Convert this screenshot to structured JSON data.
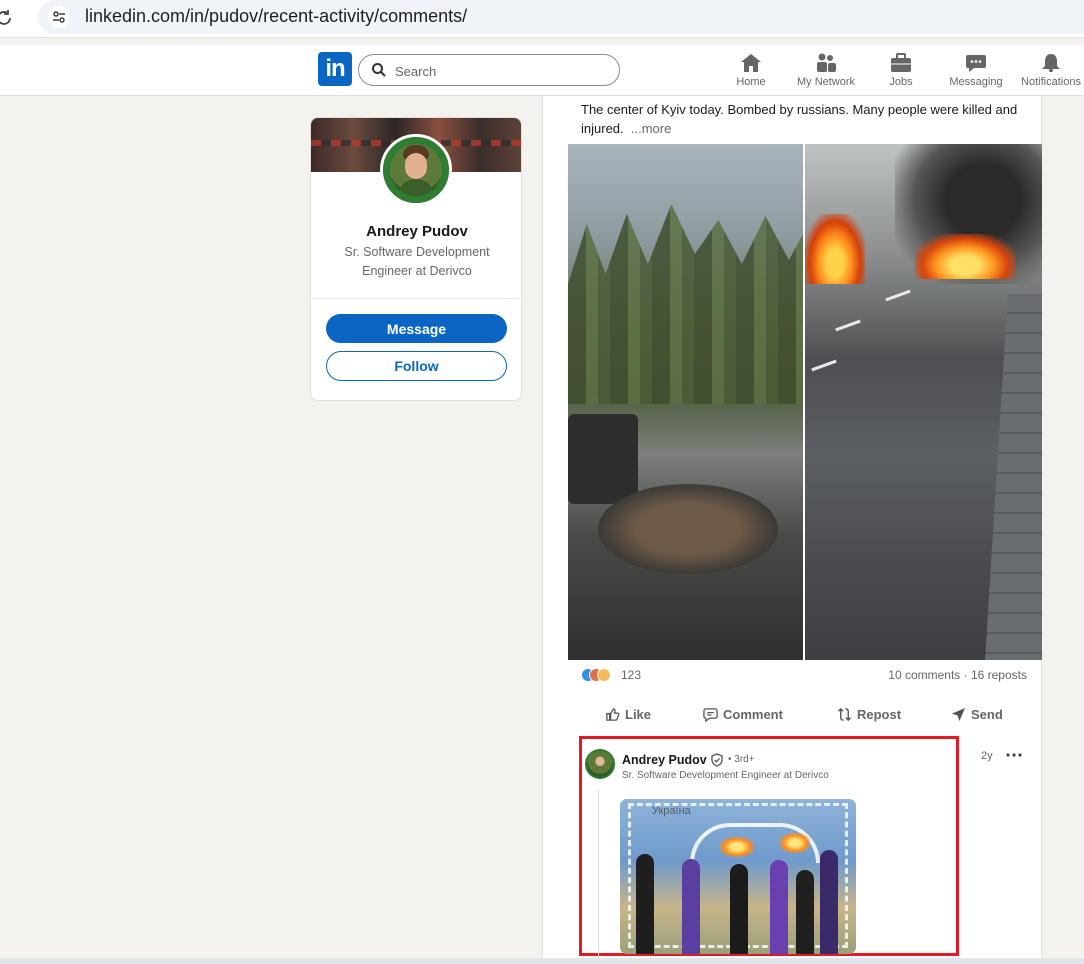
{
  "browser": {
    "url": "linkedin.com/in/pudov/recent-activity/comments/"
  },
  "nav": {
    "logo": "in",
    "search_placeholder": "Search",
    "items": [
      {
        "label": "Home",
        "icon": "home-icon"
      },
      {
        "label": "My Network",
        "icon": "network-icon"
      },
      {
        "label": "Jobs",
        "icon": "briefcase-icon"
      },
      {
        "label": "Messaging",
        "icon": "messaging-icon"
      },
      {
        "label": "Notifications",
        "icon": "bell-icon"
      }
    ]
  },
  "profile": {
    "name": "Andrey Pudov",
    "headline": "Sr. Software Development Engineer at Derivco",
    "message_label": "Message",
    "follow_label": "Follow"
  },
  "post": {
    "text": "The center of Kyiv today. Bombed by russians. Many people were killed and injured.",
    "more_label": "...more",
    "reaction_count": "123",
    "comments_reposts": "10 comments · 16 reposts",
    "actions": {
      "like": "Like",
      "comment": "Comment",
      "repost": "Repost",
      "send": "Send"
    }
  },
  "comment": {
    "author": "Andrey Pudov",
    "degree": "• 3rd+",
    "headline": "Sr. Software Development Engineer at Derivco",
    "time": "2y",
    "image_text": "Україна"
  },
  "colors": {
    "brand": "#0a66c2",
    "highlight": "#e21a24"
  }
}
